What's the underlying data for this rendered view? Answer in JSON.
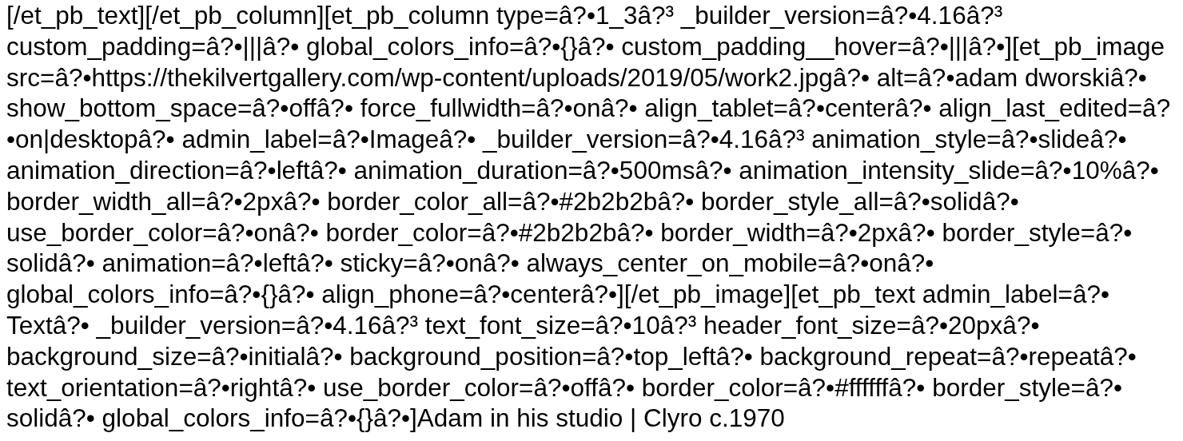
{
  "lines": [
    "[/et_pb_text][/et_pb_column][et_pb_column type=â?•1_3â?³ _builder_version=â?•4.16â?³",
    "custom_padding=â?•|||â?• global_colors_info=â?•{}â?• custom_padding__hover=â?•|||â?•][et_pb_image",
    "src=â?•https://thekilvertgallery.com/wp-content/uploads/2019/05/work2.jpgâ?• alt=â?•adam dworskiâ?•",
    "show_bottom_space=â?•offâ?• force_fullwidth=â?•onâ?• align_tablet=â?•centerâ?• align_last_edited=â?",
    "•on|desktopâ?• admin_label=â?•Imageâ?• _builder_version=â?•4.16â?³ animation_style=â?•slideâ?•",
    "animation_direction=â?•leftâ?• animation_duration=â?•500msâ?• animation_intensity_slide=â?•10%â?•",
    "border_width_all=â?•2pxâ?• border_color_all=â?•#2b2b2bâ?• border_style_all=â?•solidâ?•",
    "use_border_color=â?•onâ?• border_color=â?•#2b2b2bâ?• border_width=â?•2pxâ?• border_style=â?•",
    "solidâ?• animation=â?•leftâ?• sticky=â?•onâ?• always_center_on_mobile=â?•onâ?•",
    "global_colors_info=â?•{}â?• align_phone=â?•centerâ?•][/et_pb_image][et_pb_text admin_label=â?•",
    "Textâ?• _builder_version=â?•4.16â?³ text_font_size=â?•10â?³ header_font_size=â?•20pxâ?•",
    "background_size=â?•initialâ?• background_position=â?•top_leftâ?• background_repeat=â?•repeatâ?•",
    "text_orientation=â?•rightâ?• use_border_color=â?•offâ?• border_color=â?•#ffffffâ?• border_style=â?•",
    "solidâ?• global_colors_info=â?•{}â?•]Adam in his studio | Clyro c.1970"
  ]
}
